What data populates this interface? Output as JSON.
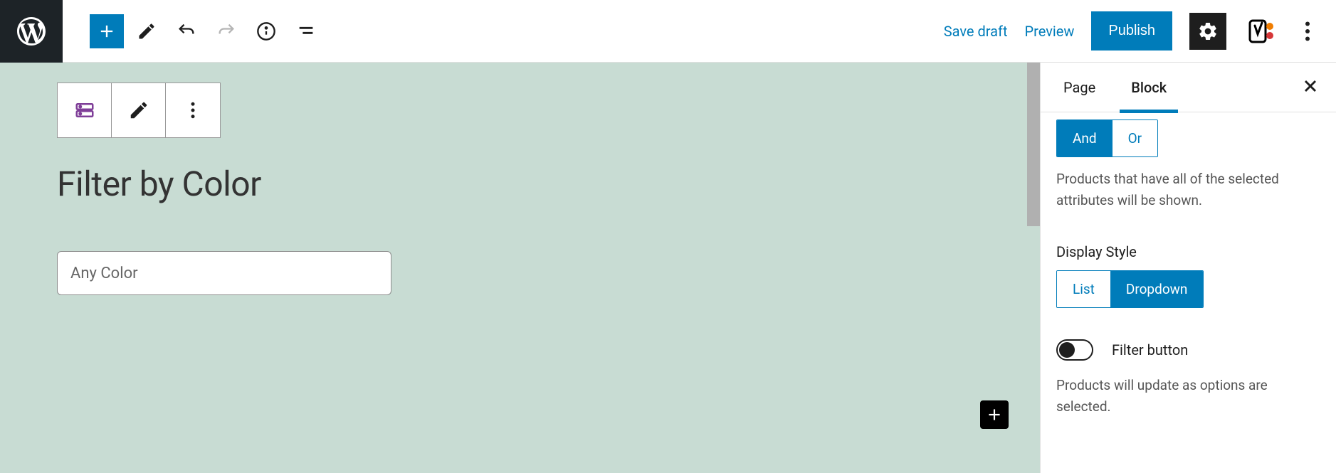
{
  "header": {
    "save_draft": "Save draft",
    "preview": "Preview",
    "publish": "Publish"
  },
  "sidebar": {
    "tabs": {
      "page": "Page",
      "block": "Block"
    },
    "query_type": {
      "options": {
        "and": "And",
        "or": "Or"
      },
      "helper": "Products that have all of the selected attributes will be shown."
    },
    "display_style": {
      "label": "Display Style",
      "options": {
        "list": "List",
        "dropdown": "Dropdown"
      }
    },
    "filter_button": {
      "label": "Filter button",
      "helper": "Products will update as options are selected."
    }
  },
  "canvas": {
    "block_title": "Filter by Color",
    "dropdown_placeholder": "Any Color"
  }
}
